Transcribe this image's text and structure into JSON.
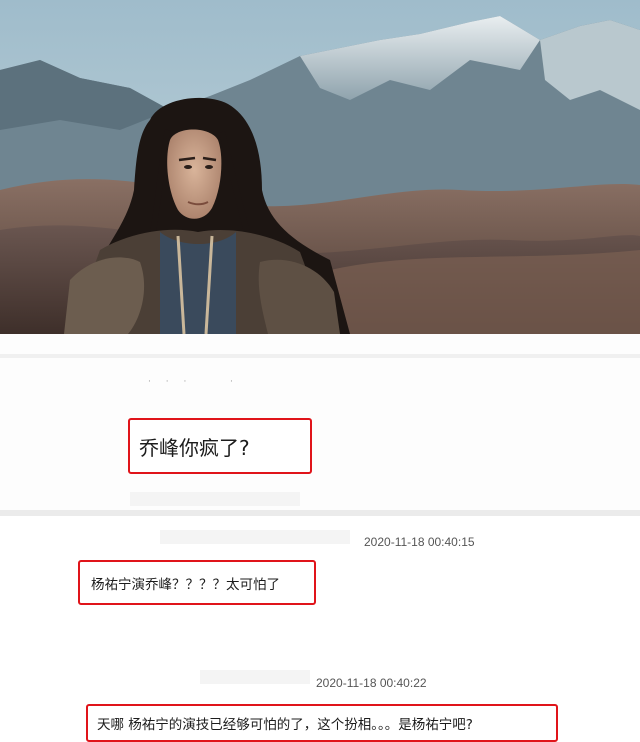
{
  "comments": [
    {
      "text": "乔峰你疯了?"
    },
    {
      "timestamp": "2020-11-18 00:40:15",
      "text": "杨祐宁演乔峰？？？？太可怕了"
    },
    {
      "timestamp": "2020-11-18 00:40:22",
      "text": "天哪 杨祐宁的演技已经够可怕的了，这个扮相。。。是杨祐宁吧?"
    }
  ],
  "colors": {
    "highlight_border": "#e0141a",
    "sky": "#a9c3cf",
    "mountain": "#7c8f9a",
    "foreground_hills": "#5f4a40"
  },
  "icons": [
    "hero-photo"
  ]
}
